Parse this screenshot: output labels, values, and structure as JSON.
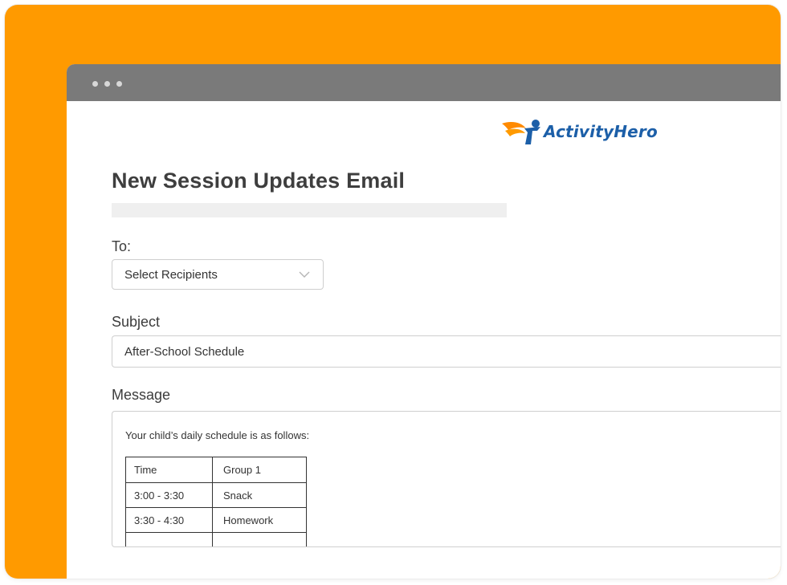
{
  "browser": {
    "window_dots": [
      "dot",
      "dot",
      "dot"
    ]
  },
  "brand": {
    "logo_text": "ActivityHero",
    "logo_icon": "activityhero-mark-icon",
    "colors": {
      "orange": "#ff9a00",
      "blue": "#1c5fa8"
    }
  },
  "page": {
    "title": "New Session Updates Email"
  },
  "to_field": {
    "label": "To:",
    "value": "Select Recipients",
    "icon": "chevron-down-icon"
  },
  "subject_field": {
    "label": "Subject",
    "value": "After-School Schedule"
  },
  "message_field": {
    "label": "Message",
    "intro": "Your child’s daily schedule is as follows:",
    "table": {
      "headers": [
        "Time",
        "Group 1"
      ],
      "rows": [
        [
          "3:00 - 3:30",
          "Snack"
        ],
        [
          "3:30 - 4:30",
          "Homework"
        ],
        [
          "",
          ""
        ]
      ]
    }
  }
}
